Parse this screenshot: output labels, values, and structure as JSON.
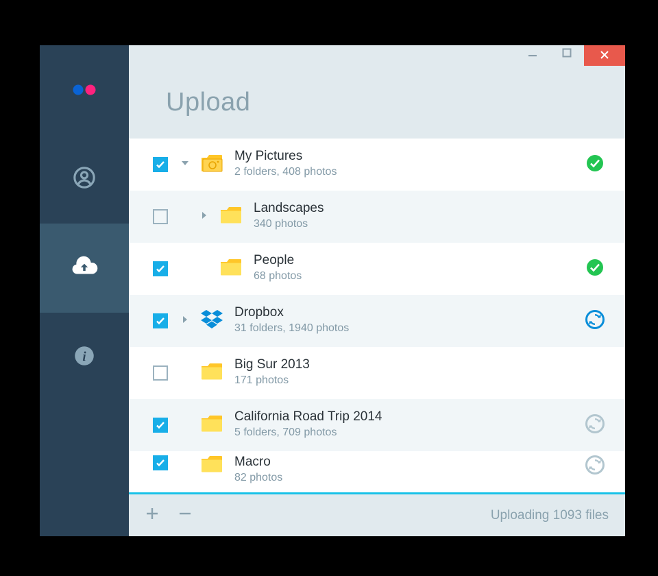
{
  "header": {
    "title": "Upload"
  },
  "sidebar": {
    "items": [
      {
        "name": "profile",
        "active": false
      },
      {
        "name": "upload",
        "active": true
      },
      {
        "name": "info",
        "active": false
      }
    ]
  },
  "folders": [
    {
      "title": "My Pictures",
      "subtitle": "2 folders, 408 photos",
      "checked": true,
      "caret": "down",
      "icon": "camera-folder",
      "status": "done",
      "alt": false,
      "indent": 0
    },
    {
      "title": "Landscapes",
      "subtitle": "340 photos",
      "checked": false,
      "caret": "right",
      "icon": "folder",
      "status": "none",
      "alt": true,
      "indent": 1
    },
    {
      "title": "People",
      "subtitle": "68 photos",
      "checked": true,
      "caret": "none",
      "icon": "folder",
      "status": "done",
      "alt": false,
      "indent": 1
    },
    {
      "title": "Dropbox",
      "subtitle": "31 folders, 1940 photos",
      "checked": true,
      "caret": "right",
      "icon": "dropbox",
      "status": "sync-active",
      "alt": true,
      "indent": 0
    },
    {
      "title": "Big Sur 2013",
      "subtitle": "171 photos",
      "checked": false,
      "caret": "none",
      "icon": "folder",
      "status": "none",
      "alt": false,
      "indent": 0
    },
    {
      "title": "California Road Trip 2014",
      "subtitle": "5 folders, 709 photos",
      "checked": true,
      "caret": "none",
      "icon": "folder",
      "status": "sync-idle",
      "alt": true,
      "indent": 0
    },
    {
      "title": "Macro",
      "subtitle": "82 photos",
      "checked": true,
      "caret": "none",
      "icon": "folder",
      "status": "sync-idle",
      "alt": false,
      "indent": 0
    }
  ],
  "footer": {
    "status": "Uploading 1093 files"
  },
  "colors": {
    "accent": "#18aee8",
    "success": "#23c552",
    "sync_active": "#0a8ed9",
    "sync_idle": "#b2c6cf",
    "sidebar": "#2a4257",
    "sidebar_active": "#3a5a6f",
    "close": "#e8594c"
  }
}
